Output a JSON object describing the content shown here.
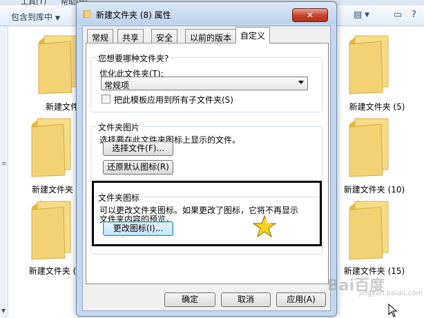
{
  "explorer": {
    "menu": [
      "工具(T)",
      "帮助(H)"
    ],
    "toolbar_include_label": "包含到库中",
    "folders_left": [
      "新建文件夹",
      "新建文件夹",
      "新建文件夹 ("
    ],
    "folders_right": [
      "新建文件夹 (5)",
      "新建文件夹 (10)",
      "新建文件夹 (15)"
    ]
  },
  "dialog": {
    "title": "新建文件夹 (8) 属性",
    "close_label": "✕",
    "tabs": [
      "常规",
      "共享",
      "安全",
      "以前的版本",
      "自定义"
    ],
    "active_tab": "自定义",
    "optimize_group": {
      "title": "您想要哪种文件夹?",
      "optimize_label": "优化此文件夹(T):",
      "selected_option": "常规项",
      "apply_template_label": "把此模板应用到所有子文件夹(S)",
      "apply_template_checked": false
    },
    "picture_group": {
      "title": "文件夹图片",
      "description": "选择要在此文件夹图标上显示的文件。",
      "choose_file_button": "选择文件(F)...",
      "restore_default_button": "还原默认图标(R)"
    },
    "icon_group": {
      "title": "文件夹图标",
      "description_line1": "可以更改文件夹图标。如果更改了图标，它将不再显示",
      "description_line2": "文件夹内容的预览。",
      "change_icon_button": "更改图标(I)..."
    },
    "footer": {
      "ok_button": "确定",
      "cancel_button": "取消",
      "apply_button": "应用(A)"
    }
  },
  "watermark": {
    "text": "Bai百度",
    "sub": "jingyan.baidu.com"
  },
  "colors": {
    "highlight_border": "#000000",
    "star": "#f7d21c",
    "folder": "#f2d274"
  }
}
